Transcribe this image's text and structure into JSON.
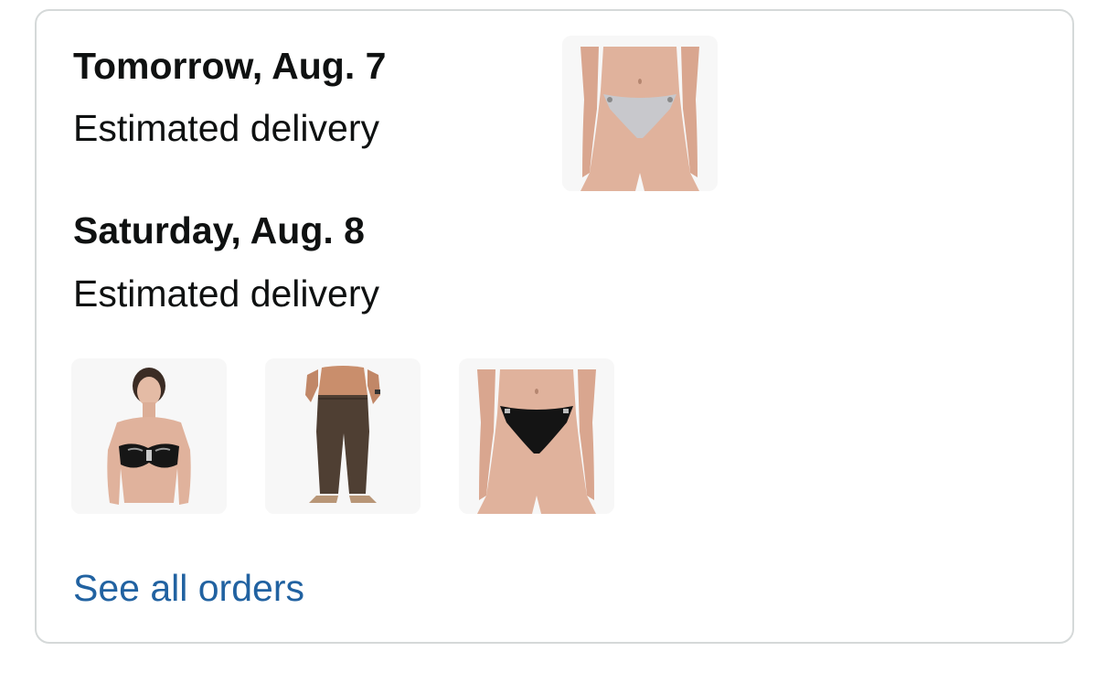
{
  "deliveries": [
    {
      "date": "Tomorrow, Aug. 7",
      "label": "Estimated delivery",
      "items": [
        {
          "icon": "product-image-grey-bikini-bottom"
        }
      ]
    },
    {
      "date": "Saturday, Aug. 8",
      "label": "Estimated delivery",
      "items": [
        {
          "icon": "product-image-black-bandeau-top"
        },
        {
          "icon": "product-image-brown-pants"
        },
        {
          "icon": "product-image-black-bikini-bottom"
        }
      ]
    }
  ],
  "see_all_orders": "See all orders",
  "colors": {
    "link": "#2162a1",
    "text": "#0f1111",
    "border": "#d5d9d9",
    "thumb_bg": "#f7f7f7"
  }
}
